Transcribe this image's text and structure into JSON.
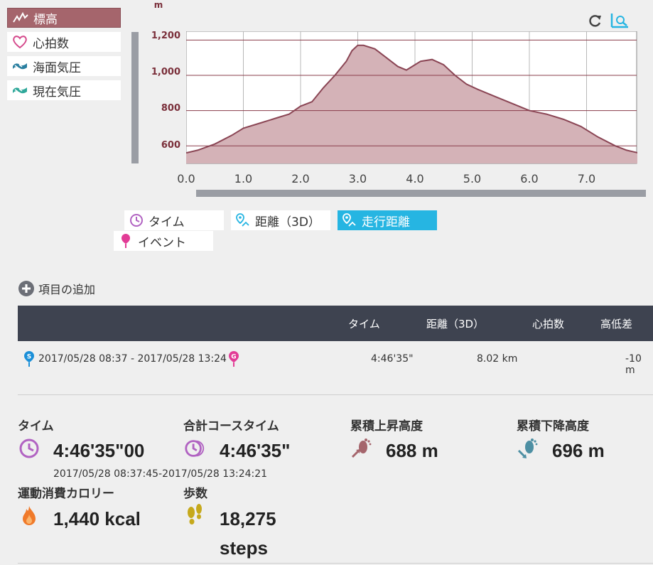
{
  "metrics": [
    {
      "label": "標高",
      "active": true,
      "icon": "elevation-icon"
    },
    {
      "label": "心拍数",
      "active": false,
      "icon": "heart-icon"
    },
    {
      "label": "海面気圧",
      "active": false,
      "icon": "sea-pressure-icon"
    },
    {
      "label": "現在気圧",
      "active": false,
      "icon": "current-pressure-icon"
    }
  ],
  "chart_data": {
    "type": "area",
    "ylabel": "m",
    "ylim": [
      500,
      1250
    ],
    "xlim": [
      0,
      7.9
    ],
    "y_ticks": [
      "1,200",
      "1,000",
      "800",
      "600"
    ],
    "x_ticks": [
      "0.0",
      "1.0",
      "2.0",
      "3.0",
      "4.0",
      "5.0",
      "6.0",
      "7.0"
    ],
    "grid": true,
    "x": [
      0,
      0.2,
      0.5,
      0.8,
      1.0,
      1.3,
      1.6,
      1.8,
      2.0,
      2.2,
      2.4,
      2.6,
      2.8,
      2.9,
      3.0,
      3.1,
      3.3,
      3.5,
      3.7,
      3.85,
      4.0,
      4.1,
      4.3,
      4.5,
      4.7,
      4.9,
      5.1,
      5.4,
      5.7,
      6.0,
      6.3,
      6.6,
      6.9,
      7.2,
      7.5,
      7.7,
      7.9
    ],
    "y": [
      560,
      575,
      610,
      660,
      700,
      730,
      760,
      780,
      825,
      850,
      930,
      1000,
      1080,
      1140,
      1170,
      1170,
      1150,
      1100,
      1050,
      1030,
      1060,
      1080,
      1090,
      1060,
      1000,
      950,
      920,
      880,
      840,
      800,
      780,
      750,
      710,
      650,
      600,
      575,
      560
    ]
  },
  "axis_buttons": {
    "time": "タイム",
    "distance3d": "距離（3D）",
    "distance": "走行距離",
    "event": "イベント"
  },
  "add_item": "項目の追加",
  "table": {
    "headers": [
      "タイム",
      "距離（3D）",
      "心拍数",
      "高低差"
    ],
    "row": {
      "period": "2017/05/28 08:37 - 2017/05/28 13:24",
      "time": "4:46'35\"",
      "distance": "8.02 km",
      "elev": "-10 m"
    }
  },
  "stats": {
    "time": {
      "label": "タイム",
      "value": "4:46'35\"00",
      "sub": "2017/05/28 08:37:45-2017/05/28 13:24:21"
    },
    "course_time": {
      "label": "合計コースタイム",
      "value": "4:46'35\""
    },
    "ascent": {
      "label": "累積上昇高度",
      "value": "688 m"
    },
    "descent": {
      "label": "累積下降高度",
      "value": "696 m"
    },
    "calories": {
      "label": "運動消費カロリー",
      "value": "1,440 kcal"
    },
    "steps": {
      "label": "歩数",
      "value": "18,275",
      "unit": "steps"
    }
  },
  "colors": {
    "active_metric": "#a5656c",
    "area_fill": "#d4b2b7",
    "area_line": "#8a4554",
    "active_axis": "#26b5e2",
    "header_bg": "#3e4350",
    "time_icon": "#b163c2"
  }
}
